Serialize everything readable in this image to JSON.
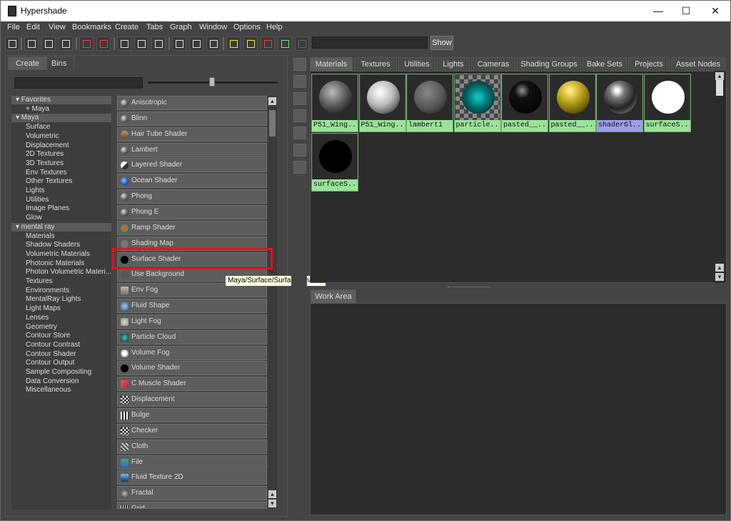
{
  "window": {
    "title": "Hypershade",
    "min": "—",
    "max": "☐",
    "close": "✕"
  },
  "menu": [
    "File",
    "Edit",
    "View",
    "Bookmarks",
    "Create",
    "Tabs",
    "Graph",
    "Window",
    "Options",
    "Help"
  ],
  "toolbar": {
    "show_label": "Show"
  },
  "left_tabs": [
    "Create",
    "Bins"
  ],
  "tree": [
    {
      "label": "▾ Favorites",
      "type": "hdr"
    },
    {
      "label": "+ Maya",
      "type": "item"
    },
    {
      "label": "▾ Maya",
      "type": "hdr"
    },
    {
      "label": "Surface",
      "type": "item"
    },
    {
      "label": "Volumetric",
      "type": "item"
    },
    {
      "label": "Displacement",
      "type": "item"
    },
    {
      "label": "2D Textures",
      "type": "item"
    },
    {
      "label": "3D Textures",
      "type": "item"
    },
    {
      "label": "Env Textures",
      "type": "item"
    },
    {
      "label": "Other Textures",
      "type": "item"
    },
    {
      "label": "Lights",
      "type": "item"
    },
    {
      "label": "Utilities",
      "type": "item"
    },
    {
      "label": "Image Planes",
      "type": "item"
    },
    {
      "label": "Glow",
      "type": "item"
    },
    {
      "label": "▾ mental ray",
      "type": "hdr"
    },
    {
      "label": "Materials",
      "type": "item"
    },
    {
      "label": "Shadow Shaders",
      "type": "item"
    },
    {
      "label": "Volumetric Materials",
      "type": "item"
    },
    {
      "label": "Photonic Materials",
      "type": "item"
    },
    {
      "label": "Photon Volumetric Materi...",
      "type": "item"
    },
    {
      "label": "Textures",
      "type": "item"
    },
    {
      "label": "Environments",
      "type": "item"
    },
    {
      "label": "MentalRay Lights",
      "type": "item"
    },
    {
      "label": "Light Maps",
      "type": "item"
    },
    {
      "label": "Lenses",
      "type": "item"
    },
    {
      "label": "Geometry",
      "type": "item"
    },
    {
      "label": "Contour Store",
      "type": "item"
    },
    {
      "label": "Contour Contrast",
      "type": "item"
    },
    {
      "label": "Contour Shader",
      "type": "item"
    },
    {
      "label": "Contour Output",
      "type": "item"
    },
    {
      "label": "Sample Compositing",
      "type": "item"
    },
    {
      "label": "Data Conversion",
      "type": "item"
    },
    {
      "label": "Miscellaneous",
      "type": "item"
    }
  ],
  "shaders": [
    "Anisotropic",
    "Blinn",
    "Hair Tube Shader",
    "Lambert",
    "Layered Shader",
    "Ocean Shader",
    "Phong",
    "Phong E",
    "Ramp Shader",
    "Shading Map",
    "Surface Shader",
    "Use Background",
    "Env Fog",
    "Fluid Shape",
    "Light Fog",
    "Particle Cloud",
    "Volume Fog",
    "Volume Shader",
    "C Muscle Shader",
    "Displacement",
    "Bulge",
    "Checker",
    "Cloth",
    "File",
    "Fluid Texture 2D",
    "Fractal",
    "Grid"
  ],
  "tooltip": "Maya/Surface/Surface Shader",
  "right_tabs": [
    "Materials",
    "Textures",
    "Utilities",
    "Lights",
    "Cameras",
    "Shading Groups",
    "Bake Sets",
    "Projects",
    "Asset Nodes"
  ],
  "swatches": [
    {
      "label": "P51_Wing...",
      "kind": "grey"
    },
    {
      "label": "P51_Wing...",
      "kind": "white"
    },
    {
      "label": "lambert1",
      "kind": "lambert"
    },
    {
      "label": "particle...",
      "kind": "checker"
    },
    {
      "label": "pasted__...",
      "kind": "black"
    },
    {
      "label": "pasted__...",
      "kind": "gold"
    },
    {
      "label": "shaderGl...",
      "kind": "glossy"
    },
    {
      "label": "surfaceS...",
      "kind": "flatwhite"
    },
    {
      "label": "surfaceS...",
      "kind": "flatblack"
    }
  ],
  "work_area_tab": "Work Area",
  "colors": {
    "highlight": "#e0141e",
    "swatch_label": "#9ae39a",
    "selected_label": "#9e9ee8",
    "tooltip_bg": "#ffffe1"
  }
}
